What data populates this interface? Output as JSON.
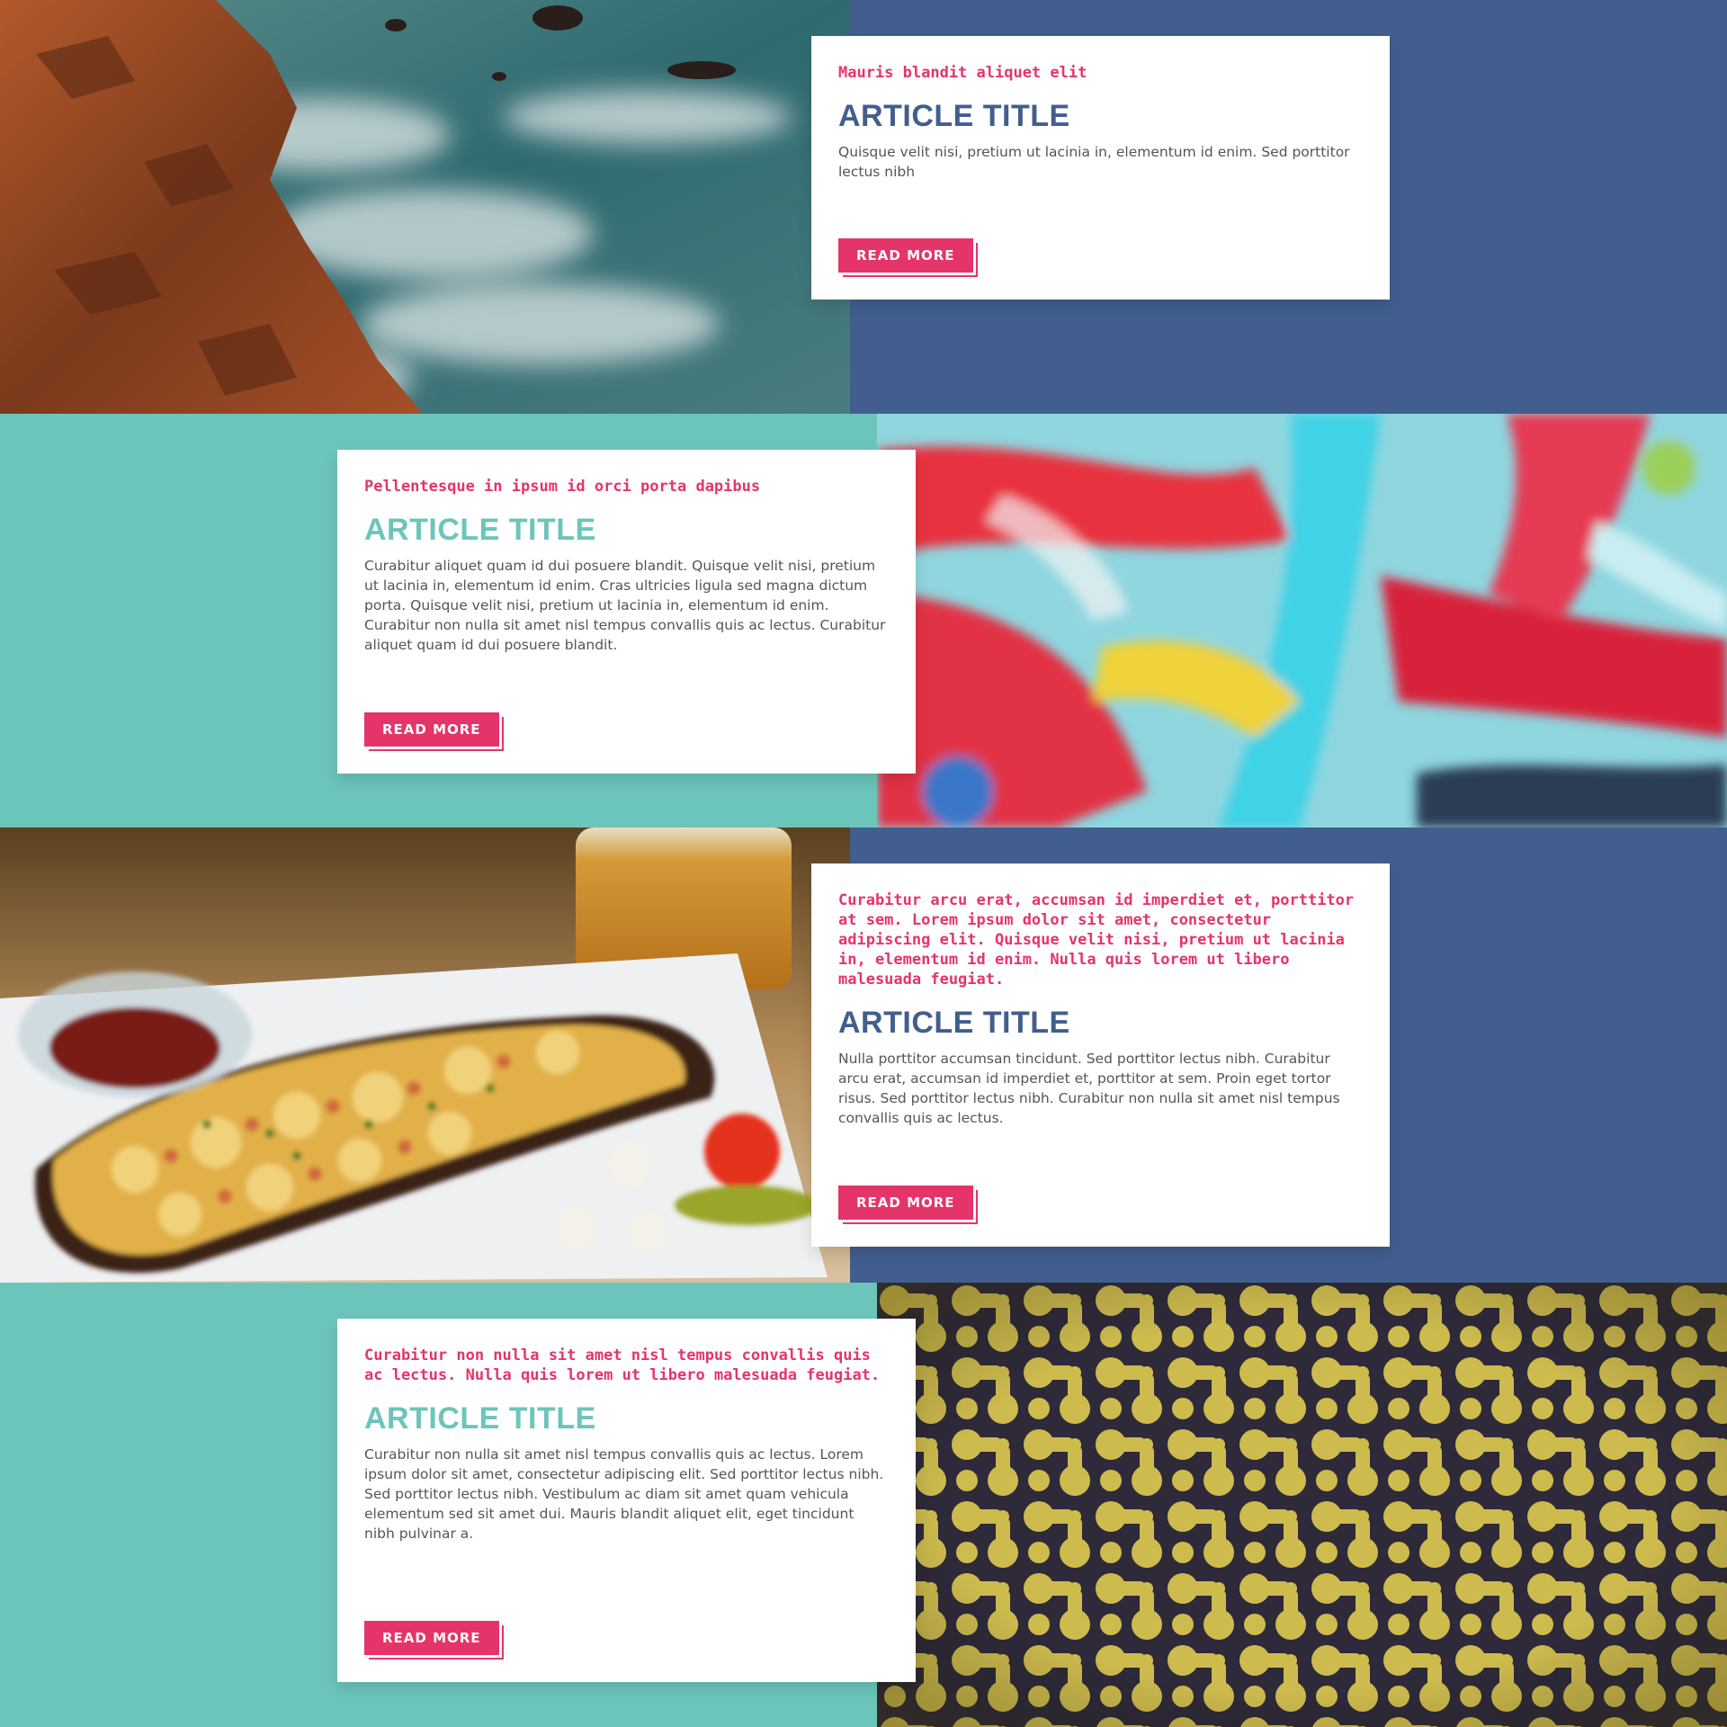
{
  "articles": [
    {
      "kicker": "Mauris blandit aliquet elit",
      "title": "ARTICLE TITLE",
      "body": "Quisque velit nisi, pretium ut lacinia in, elementum id enim. Sed porttitor lectus nibh",
      "button": "READ MORE",
      "image": "rocky-coast-photo",
      "title_color": "#415e8e",
      "background": "#415e8e"
    },
    {
      "kicker": "Pellentesque in ipsum id orci porta dapibus",
      "title": "ARTICLE TITLE",
      "body": "Curabitur aliquet quam id dui posuere blandit. Quisque velit nisi, pretium ut lacinia in, elementum id enim. Cras ultricies ligula sed magna dictum porta. Quisque velit nisi, pretium ut lacinia in, elementum id enim. Curabitur non nulla sit amet nisl tempus convallis quis ac lectus. Curabitur aliquet quam id dui posuere blandit.",
      "button": "READ MORE",
      "image": "abstract-paint-photo",
      "title_color": "#6cc5bb",
      "background": "#6cc5bb"
    },
    {
      "kicker": "Curabitur arcu erat, accumsan id imperdiet et, porttitor at sem. Lorem ipsum dolor sit amet, consectetur adipiscing elit. Quisque velit nisi, pretium ut lacinia in, elementum id enim. Nulla quis lorem ut libero malesuada feugiat.",
      "title": "ARTICLE TITLE",
      "body": "Nulla porttitor accumsan tincidunt. Sed porttitor lectus nibh. Curabitur arcu erat, accumsan id imperdiet et, porttitor at sem. Proin eget tortor risus. Sed porttitor lectus nibh. Curabitur non nulla sit amet nisl tempus convallis quis ac lectus.",
      "button": "READ MORE",
      "image": "pizza-bread-photo",
      "title_color": "#415e8e",
      "background": "#415e8e"
    },
    {
      "kicker": "Curabitur non nulla sit amet nisl tempus convallis quis ac lectus. Nulla quis lorem ut libero malesuada feugiat.",
      "title": "ARTICLE TITLE",
      "body": "Curabitur non nulla sit amet nisl tempus convallis quis ac lectus. Lorem ipsum dolor sit amet, consectetur adipiscing elit. Sed porttitor lectus nibh. Sed porttitor lectus nibh. Vestibulum ac diam sit amet quam vehicula elementum sed sit amet dui. Mauris blandit aliquet elit, eget tincidunt nibh pulvinar a.",
      "button": "READ MORE",
      "image": "yellow-pattern-photo",
      "title_color": "#6cc5bb",
      "background": "#6cc5bb"
    }
  ],
  "colors": {
    "accent": "#e5346a",
    "navy": "#415e8e",
    "teal": "#6cc5bb"
  }
}
